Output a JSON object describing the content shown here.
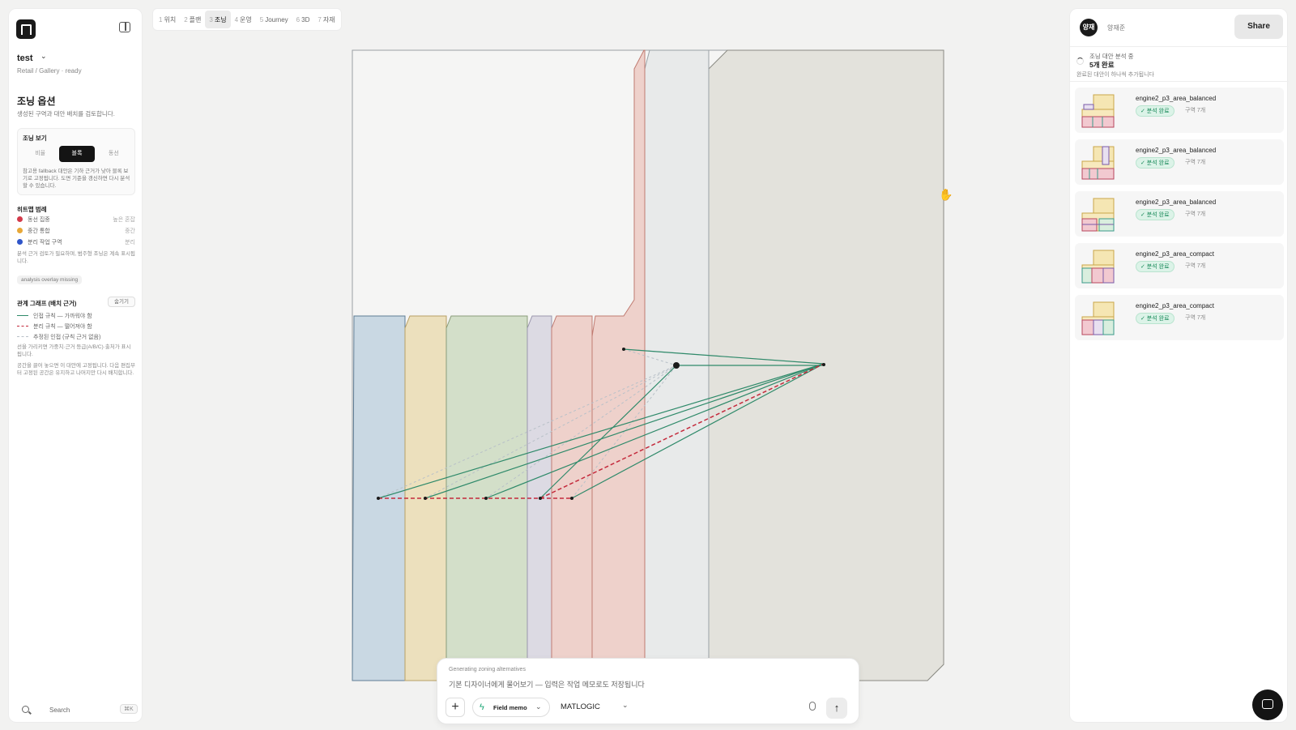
{
  "project": {
    "name": "test",
    "breadcrumb": "Retail / Gallery · ready"
  },
  "section": {
    "title": "조닝 옵션",
    "desc": "생성된 구역과 대안 배치를 검토합니다."
  },
  "view_card": {
    "title": "조닝 보기",
    "modes": [
      "비율",
      "블록",
      "동선"
    ],
    "active_mode": "블록",
    "note": "참고용 fallback 대안은 기하 근거가 낮아 블록 보기로 고정됩니다. 도면 기준을 갱신하면 다시 분석할 수 있습니다."
  },
  "heatmap_legend": {
    "title": "히트맵 범례",
    "items": [
      {
        "label": "동선 집중",
        "right": "높은 혼잡",
        "color": "#d33a4a"
      },
      {
        "label": "중간 통합",
        "right": "중간",
        "color": "#e8a838"
      },
      {
        "label": "분리 작업 구역",
        "right": "분리",
        "color": "#2f55c9"
      }
    ],
    "note": "분석 근거 검토가 필요하며, 범주형 조닝은 계속 표시됩니다.",
    "chip": "analysis overlay missing"
  },
  "relation_graph": {
    "title": "관계 그래프 (배치 근거)",
    "hide_label": "숨기기",
    "items": [
      {
        "label": "인접 규칙 — 가까워야 함",
        "style": "adjacent"
      },
      {
        "label": "분리 규칙 — 떨어져야 함",
        "style": "separate"
      },
      {
        "label": "추정된 인접 (규칙 근거 없음)",
        "style": "inferred"
      }
    ],
    "note1": "선을 가리키면 가중치·근거 등급(A/B/C)·출처가 표시됩니다.",
    "note2": "공간을 끌어 놓으면 이 대안에 고정됩니다. 다음 편집부터 고정된 공간은 유지하고 나머지만 다시 배치합니다."
  },
  "search": {
    "label": "Search",
    "shortcut": "⌘K"
  },
  "tabs": [
    {
      "num": "1",
      "label": "위치"
    },
    {
      "num": "2",
      "label": "플랜"
    },
    {
      "num": "3",
      "label": "조닝",
      "active": true
    },
    {
      "num": "4",
      "label": "운영"
    },
    {
      "num": "5",
      "label": "Journey"
    },
    {
      "num": "6",
      "label": "3D"
    },
    {
      "num": "7",
      "label": "자재"
    }
  ],
  "chat": {
    "status": "Generating zoning alternatives",
    "placeholder": "기본 디자이너에게 물어보기 — 입력은 작업 메모로도 저장됩니다",
    "memo_label": "Field memo",
    "model": "MATLOGIC"
  },
  "right_panel": {
    "avatar": "양재",
    "user": "양재준",
    "share": "Share",
    "progress_status": "조닝 대안 분석 중",
    "progress_count": "5개 완료",
    "progress_note": "완료된 대안이 하나씩 추가됩니다",
    "alternatives": [
      {
        "name": "engine2_p3_area_balanced",
        "status": "✓ 분석 완료",
        "count": "구역 7개"
      },
      {
        "name": "engine2_p3_area_balanced",
        "status": "✓ 분석 완료",
        "count": "구역 7개"
      },
      {
        "name": "engine2_p3_area_balanced",
        "status": "✓ 분석 완료",
        "count": "구역 7개"
      },
      {
        "name": "engine2_p3_area_compact",
        "status": "✓ 분석 완료",
        "count": "구역 7개"
      },
      {
        "name": "engine2_p3_area_compact",
        "status": "✓ 분석 완료",
        "count": "구역 7개"
      }
    ]
  },
  "canvas": {
    "zone_colors": [
      "#c9d8e3",
      "#ece0bd",
      "#d3dfc9",
      "#dcdae3",
      "#eed1cb",
      "#eed1cb",
      "#e8eaea",
      "#e3e2dc"
    ],
    "relation_colors": {
      "adjacent": "#2f8a6a",
      "separate": "#c42a3c",
      "inferred": "#b8c0c8"
    },
    "icons": {
      "logo": "app-logo-icon",
      "panel": "panel-toggle-icon",
      "cursor": "hand-cursor-icon",
      "chat_fab": "chat-bubble-icon"
    }
  }
}
